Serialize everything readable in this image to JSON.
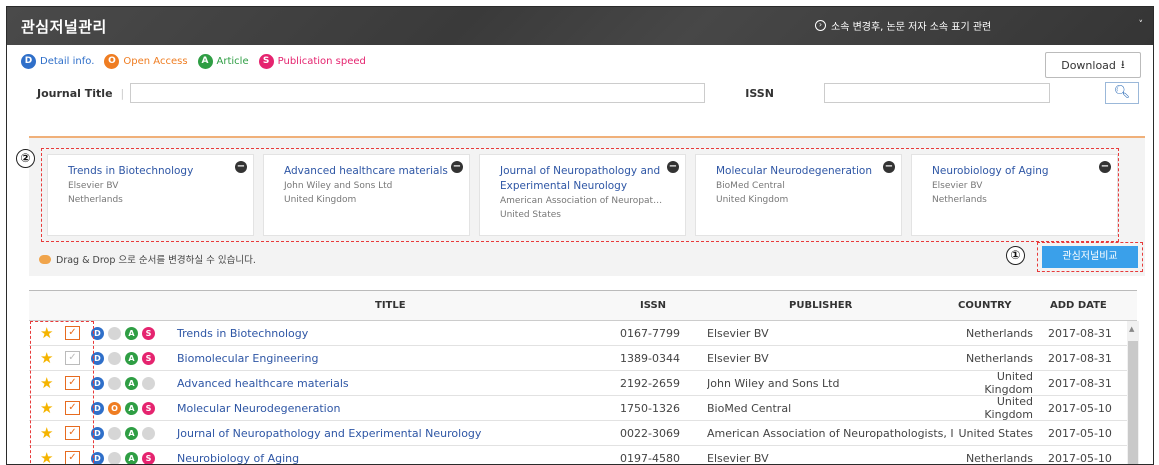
{
  "header": {
    "title": "관심저널관리",
    "notice": "소속 변경후, 논문 저자 소속 표기 관련",
    "notice_icon": "circle-arrow-icon",
    "chevron": "˅"
  },
  "legend": [
    {
      "letter": "D",
      "label": "Detail info.",
      "color": "#2f6fc9"
    },
    {
      "letter": "O",
      "label": "Open Access",
      "color": "#ef7d22"
    },
    {
      "letter": "A",
      "label": "Article",
      "color": "#2f9e44"
    },
    {
      "letter": "S",
      "label": "Publication speed",
      "color": "#e5246f"
    }
  ],
  "download": {
    "label": "Download"
  },
  "search": {
    "journal_label": "Journal Title",
    "journal_value": "",
    "issn_label": "ISSN",
    "issn_value": ""
  },
  "annotations": {
    "one": "①",
    "two": "②"
  },
  "cards": [
    {
      "title": "Trends in Biotechnology",
      "publisher": "Elsevier BV",
      "country": "Netherlands"
    },
    {
      "title": "Advanced healthcare materials",
      "publisher": "John Wiley and Sons Ltd",
      "country": "United Kingdom"
    },
    {
      "title": "Journal of Neuropathology and Experimental Neurology",
      "publisher": "American Association of Neuropat…",
      "country": "United States"
    },
    {
      "title": "Molecular Neurodegeneration",
      "publisher": "BioMed Central",
      "country": "United Kingdom"
    },
    {
      "title": "Neurobiology of Aging",
      "publisher": "Elsevier BV",
      "country": "Netherlands"
    }
  ],
  "dnd_hint": "Drag & Drop 으로 순서를 변경하실 수 있습니다.",
  "compare_button": "관심저널비교",
  "table": {
    "headers": {
      "title": "TITLE",
      "issn": "ISSN",
      "publisher": "PUBLISHER",
      "country": "COUNTRY",
      "date": "ADD DATE"
    },
    "rows": [
      {
        "title": "Trends in Biotechnology",
        "issn": "0167-7799",
        "publisher": "Elsevier BV",
        "country": "Netherlands",
        "date": "2017-08-31",
        "checked": true,
        "badges": [
          1,
          0,
          1,
          1
        ]
      },
      {
        "title": "Biomolecular Engineering",
        "issn": "1389-0344",
        "publisher": "Elsevier BV",
        "country": "Netherlands",
        "date": "2017-08-31",
        "checked": false,
        "badges": [
          1,
          0,
          1,
          1
        ]
      },
      {
        "title": "Advanced healthcare materials",
        "issn": "2192-2659",
        "publisher": "John Wiley and Sons Ltd",
        "country": "United Kingdom",
        "date": "2017-08-31",
        "checked": true,
        "badges": [
          1,
          0,
          1,
          0
        ]
      },
      {
        "title": "Molecular Neurodegeneration",
        "issn": "1750-1326",
        "publisher": "BioMed Central",
        "country": "United Kingdom",
        "date": "2017-05-10",
        "checked": true,
        "badges": [
          1,
          1,
          1,
          1
        ]
      },
      {
        "title": "Journal of Neuropathology and Experimental Neurology",
        "issn": "0022-3069",
        "publisher": "American Association of Neuropathologists, I",
        "country": "United States",
        "date": "2017-05-10",
        "checked": true,
        "badges": [
          1,
          0,
          1,
          0
        ]
      },
      {
        "title": "Neurobiology of Aging",
        "issn": "0197-4580",
        "publisher": "Elsevier BV",
        "country": "Netherlands",
        "date": "2017-05-10",
        "checked": true,
        "badges": [
          1,
          0,
          1,
          1
        ]
      }
    ]
  }
}
